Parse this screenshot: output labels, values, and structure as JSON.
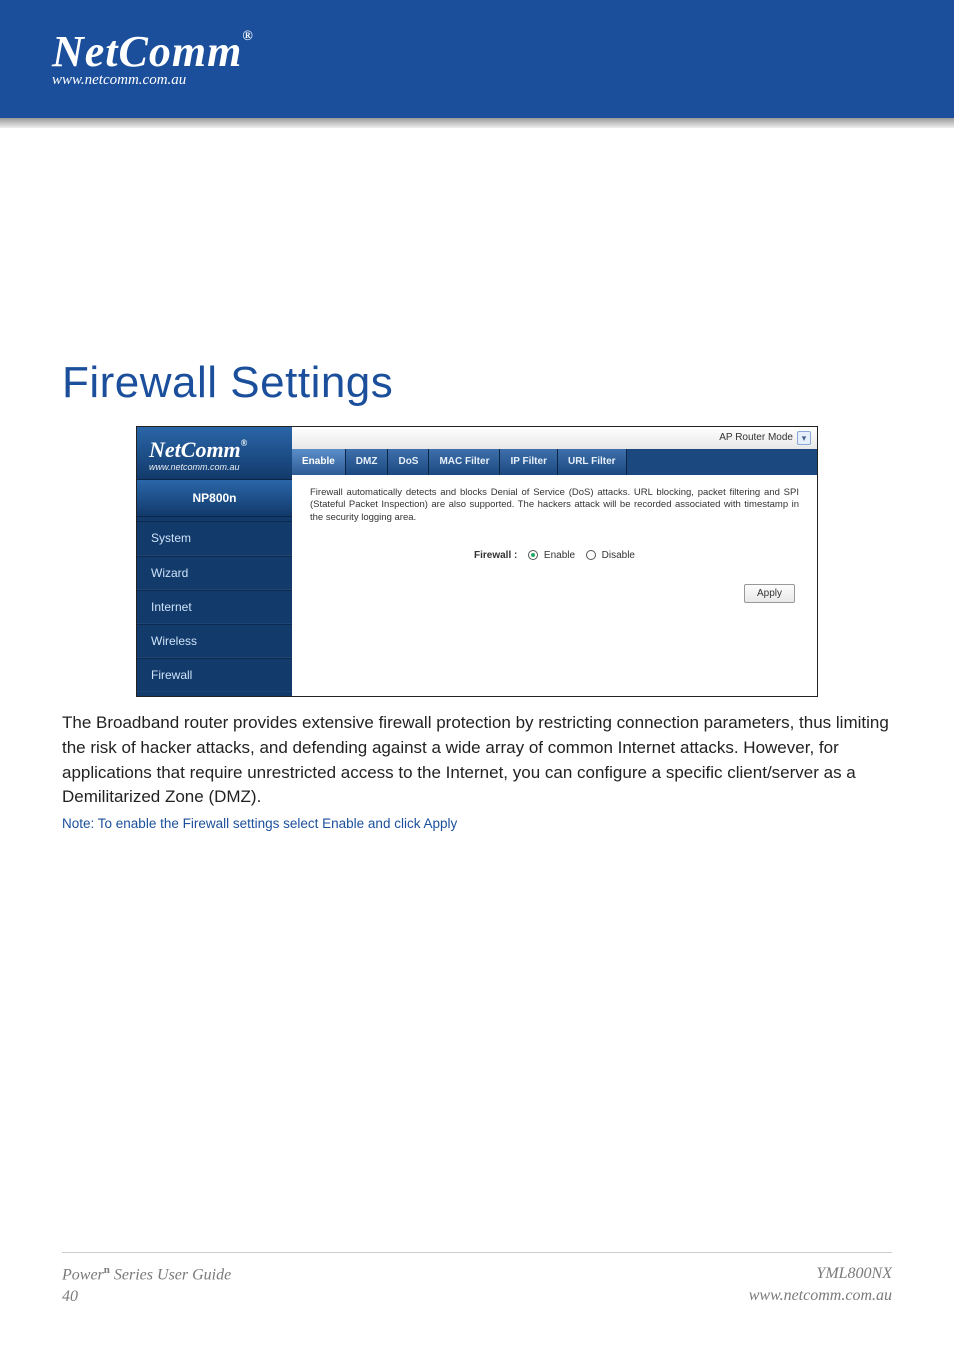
{
  "banner": {
    "brand": "NetComm",
    "url": "www.netcomm.com.au",
    "trademark": "®"
  },
  "page": {
    "title": "Firewall Settings",
    "paragraph": "The Broadband router provides extensive firewall protection by restricting connection parameters, thus limiting the risk of hacker attacks, and defending against a wide array of common Internet attacks. However, for applications that require unrestricted access to the Internet, you can configure a specific client/server as a Demilitarized Zone (DMZ).",
    "note": "Note: To enable the Firewall settings select Enable and click Apply"
  },
  "router": {
    "logo_brand": "NetComm",
    "logo_url": "www.netcomm.com.au",
    "logo_tm": "®",
    "model": "NP800n",
    "sidebar_items": [
      "System",
      "Wizard",
      "Internet",
      "Wireless",
      "Firewall"
    ],
    "mode_label": "AP Router Mode",
    "tabs": [
      "Enable",
      "DMZ",
      "DoS",
      "MAC Filter",
      "IP Filter",
      "URL Filter"
    ],
    "description": "Firewall automatically detects and blocks Denial of Service (DoS) attacks. URL blocking, packet filtering and SPI (Stateful Packet Inspection) are also supported. The hackers attack will be recorded associated with timestamp in the security logging area.",
    "option_label": "Firewall :",
    "option_enable": "Enable",
    "option_disable": "Disable",
    "apply_label": "Apply",
    "dropdown_glyph": "▾"
  },
  "footer": {
    "left_line1_prefix": "Power",
    "left_line1_sup": "n",
    "left_line1_suffix": " Series User Guide",
    "left_line2": "40",
    "right_line1": "YML800NX",
    "right_line2": "www.netcomm.com.au"
  }
}
